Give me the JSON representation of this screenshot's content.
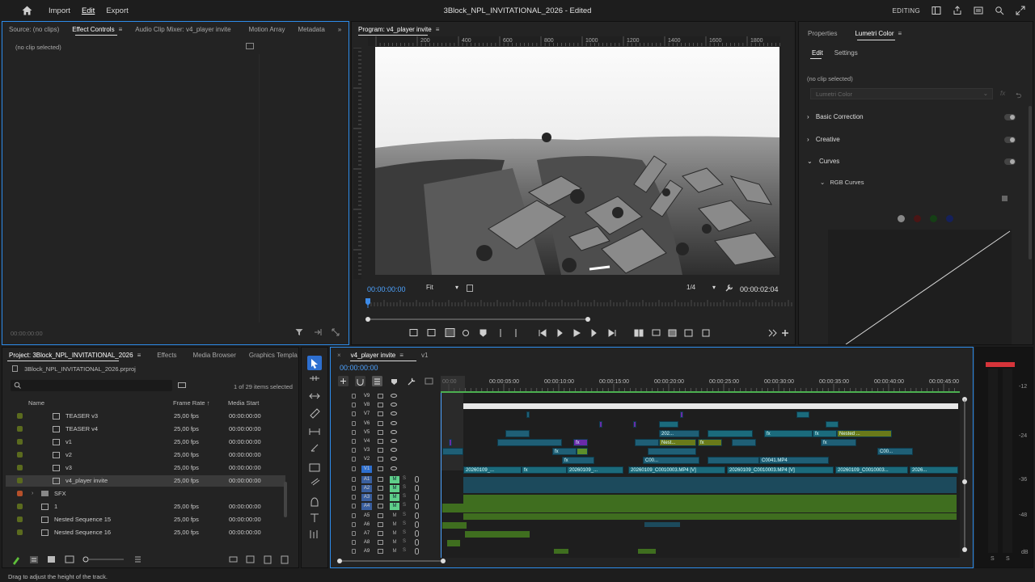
{
  "menubar": {
    "items": [
      "Import",
      "Edit",
      "Export"
    ],
    "active": "Edit",
    "title": "3Block_NPL_INVITATIONAL_2026 - Edited",
    "workspace_label": "EDITING"
  },
  "source_panel": {
    "tabs": [
      "Source: (no clips)",
      "Effect Controls",
      "Audio Clip Mixer: v4_player invite",
      "Motion Array",
      "Metadata"
    ],
    "active_tab": "Effect Controls",
    "no_clip": "(no clip selected)",
    "timecode": "00:00:00:00"
  },
  "program_monitor": {
    "tab": "Program: v4_player invite",
    "ruler_ticks": [
      "200",
      "400",
      "600",
      "800",
      "1000",
      "1200",
      "1400",
      "1600",
      "1800"
    ],
    "timecode": "00:00:00:00",
    "fit": "Fit",
    "resolution": "1/4",
    "duration": "00:00:02:04",
    "image_description_alt": "Aerial drone view"
  },
  "lumetri": {
    "tabs": [
      "Properties",
      "Lumetri Color"
    ],
    "active_tab": "Lumetri Color",
    "subtabs": [
      "Edit",
      "Settings"
    ],
    "active_subtab": "Edit",
    "no_clip": "(no clip selected)",
    "dropdown": "Lumetri Color",
    "sections": [
      "Basic Correction",
      "Creative",
      "Curves"
    ],
    "subsection": "RGB Curves"
  },
  "project_panel": {
    "tabs": [
      "Project: 3Block_NPL_INVITATIONAL_2026",
      "Effects",
      "Media Browser",
      "Graphics Templa"
    ],
    "active_tab": "Project: 3Block_NPL_INVITATIONAL_2026",
    "file": "3Block_NPL_INVITATIONAL_2026.prproj",
    "selection_count": "1 of 29 items selected",
    "columns": [
      "Name",
      "Frame Rate",
      "Media Start"
    ],
    "rows": [
      {
        "name": "TEASER v3",
        "fps": "25,00 fps",
        "start": "00:00:00:00",
        "color": "#5b6b1e",
        "type": "seq",
        "indent": 2
      },
      {
        "name": "TEASER v4",
        "fps": "25,00 fps",
        "start": "00:00:00:00",
        "color": "#5b6b1e",
        "type": "seq",
        "indent": 2
      },
      {
        "name": "v1",
        "fps": "25,00 fps",
        "start": "00:00:00:00",
        "color": "#5b6b1e",
        "type": "seq",
        "indent": 2
      },
      {
        "name": "v2",
        "fps": "25,00 fps",
        "start": "00:00:00:00",
        "color": "#5b6b1e",
        "type": "seq",
        "indent": 2
      },
      {
        "name": "v3",
        "fps": "25,00 fps",
        "start": "00:00:00:00",
        "color": "#5b6b1e",
        "type": "seq",
        "indent": 2
      },
      {
        "name": "v4_player invite",
        "fps": "25,00 fps",
        "start": "00:00:00:00",
        "color": "#5b6b1e",
        "type": "seq",
        "indent": 2,
        "selected": true
      },
      {
        "name": "SFX",
        "fps": "",
        "start": "",
        "color": "#b5502a",
        "type": "folder",
        "indent": 1
      },
      {
        "name": "1",
        "fps": "25,00 fps",
        "start": "00:00:00:00",
        "color": "#5b6b1e",
        "type": "seq",
        "indent": 1
      },
      {
        "name": "Nested Sequence 15",
        "fps": "25,00 fps",
        "start": "00:00:00:00",
        "color": "#5b6b1e",
        "type": "seq",
        "indent": 1
      },
      {
        "name": "Nested Sequence 16",
        "fps": "25,00 fps",
        "start": "00:00:00:00",
        "color": "#5b6b1e",
        "type": "seq",
        "indent": 1
      }
    ]
  },
  "timeline": {
    "tabs": [
      "v4_player invite",
      "v1"
    ],
    "active_tab": "v4_player invite",
    "timecode": "00:00:00:00",
    "ruler": [
      "00:00",
      "00:00:05:00",
      "00:00:10:00",
      "00:00:15:00",
      "00:00:20:00",
      "00:00:25:00",
      "00:00:30:00",
      "00:00:35:00",
      "00:00:40:00",
      "00:00:45:00"
    ],
    "video_tracks": [
      "V9",
      "V8",
      "V7",
      "V6",
      "V5",
      "V4",
      "V3",
      "V2",
      "V1"
    ],
    "audio_tracks": [
      "A1",
      "A2",
      "A3",
      "A4",
      "A5",
      "A6",
      "A7",
      "A8",
      "A9"
    ],
    "clip_labels": [
      "20260109_...",
      "20260109_...",
      "20260109_C0010003.MP4 [V]",
      "20260109_C0010003.MP4 [V]",
      "20260109_C0010003...",
      "2026...",
      "C0041.MP4",
      "C00...",
      "C00...",
      "Nested ...",
      "Nest...",
      "202..."
    ],
    "fx": "fx"
  },
  "meter": {
    "scale": [
      "-12",
      "-24",
      "-36",
      "-48",
      "dB"
    ],
    "solo": [
      "S",
      "S"
    ]
  },
  "status_bar": "Drag to adjust the height of the track."
}
